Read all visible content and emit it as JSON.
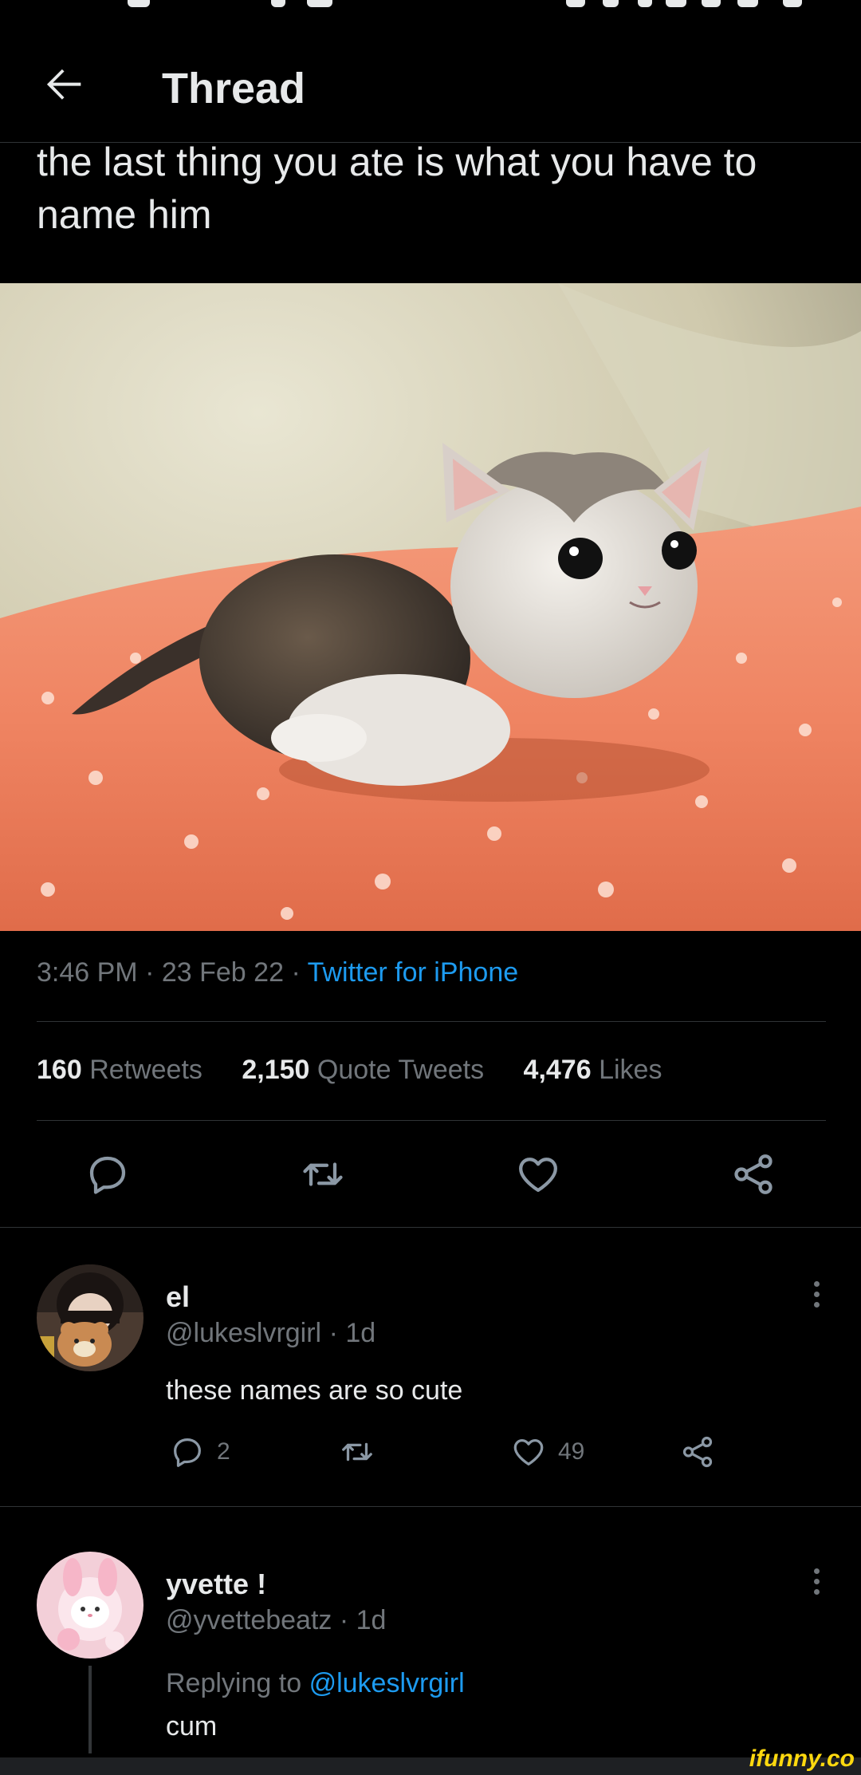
{
  "header": {
    "title": "Thread"
  },
  "tweet": {
    "text": "the last thing you ate is what you have to name him",
    "time": "3:46 PM",
    "date": "23 Feb 22",
    "source": "Twitter for iPhone",
    "retweets": "160",
    "retweets_label": "Retweets",
    "quotes": "2,150",
    "quotes_label": "Quote Tweets",
    "likes": "4,476",
    "likes_label": "Likes"
  },
  "replies": [
    {
      "name": "el",
      "handle": "@lukeslvrgirl",
      "age": "1d",
      "text": "these names are so cute",
      "reply_count": "2",
      "like_count": "49"
    },
    {
      "name": "yvette !",
      "handle": "@yvettebeatz",
      "age": "1d",
      "replying_prefix": "Replying to",
      "replying_to": "@lukeslvrgirl",
      "text": "cum"
    }
  ],
  "watermark": "ifunny.co",
  "colors": {
    "background": "#000000",
    "text_primary": "#e7e9ea",
    "text_secondary": "#71767b",
    "link": "#1d9bf0",
    "divider": "#2f3336"
  },
  "icons": [
    "back-arrow-icon",
    "reply-icon",
    "retweet-icon",
    "heart-icon",
    "share-icon",
    "more-icon"
  ]
}
